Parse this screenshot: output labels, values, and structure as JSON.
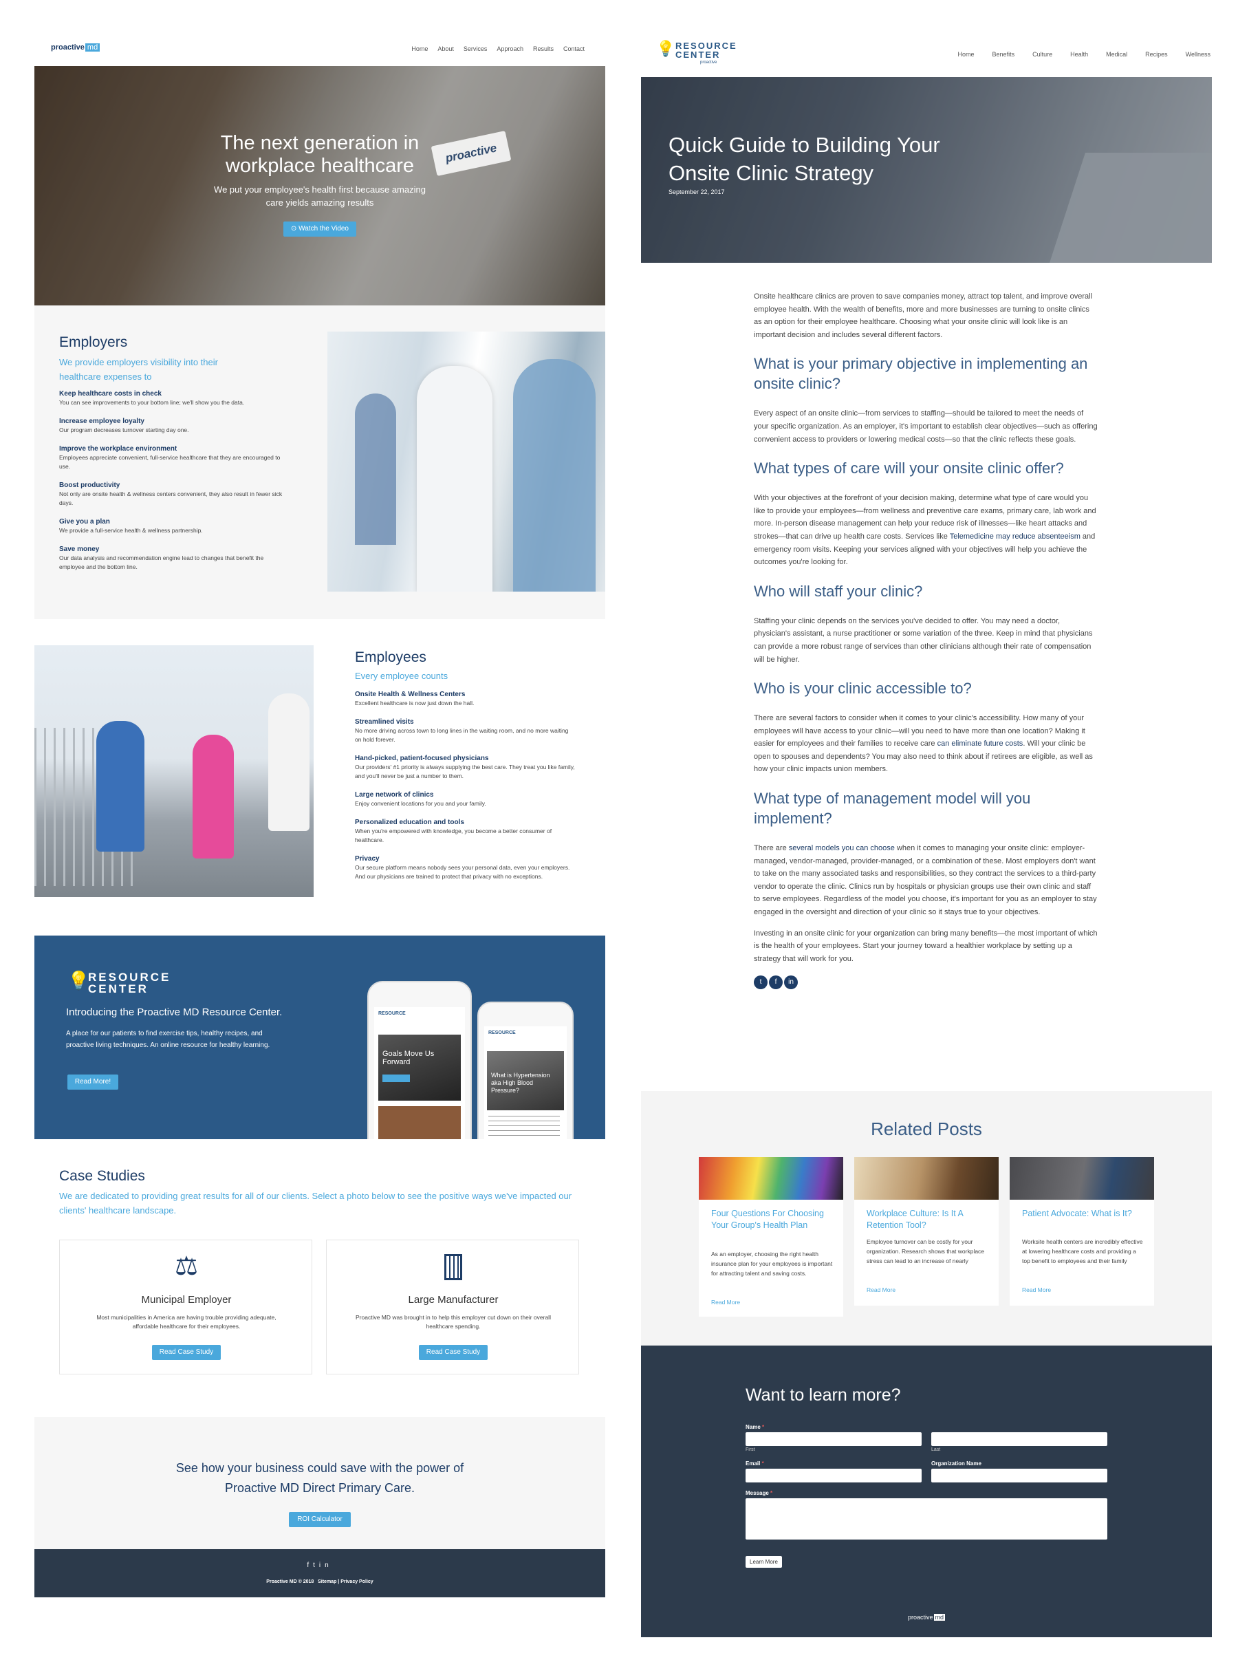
{
  "left": {
    "logo": {
      "text": "proactive",
      "badge": "md"
    },
    "nav": [
      "Home",
      "About",
      "Services",
      "Approach",
      "Results",
      "Contact"
    ],
    "hero": {
      "title": "The next generation in workplace healthcare",
      "subtitle": "We put your employee's health first because amazing care yields amazing results",
      "button": "⊙ Watch the Video"
    },
    "employers": {
      "title": "Employers",
      "subtitle": "We provide employers visibility into their healthcare expenses to",
      "features": [
        {
          "title": "Keep healthcare costs in check",
          "desc": "You can see improvements to your bottom line; we'll show you the data."
        },
        {
          "title": "Increase employee loyalty",
          "desc": "Our program decreases turnover starting day one."
        },
        {
          "title": "Improve the workplace environment",
          "desc": "Employees appreciate convenient, full-service healthcare that they are encouraged to use."
        },
        {
          "title": "Boost productivity",
          "desc": "Not only are onsite health & wellness centers convenient, they also result in fewer sick days."
        },
        {
          "title": "Give you a plan",
          "desc": "We provide a full-service health & wellness partnership."
        },
        {
          "title": "Save money",
          "desc": "Our data analysis and recommendation engine lead to changes that benefit the employee and the bottom line."
        }
      ]
    },
    "employees": {
      "title": "Employees",
      "subtitle": "Every employee counts",
      "features": [
        {
          "title": "Onsite Health & Wellness Centers",
          "desc": "Excellent healthcare is now just down the hall."
        },
        {
          "title": "Streamlined visits",
          "desc": "No more driving across town to long lines in the waiting room, and no more waiting on hold forever."
        },
        {
          "title": "Hand-picked, patient-focused physicians",
          "desc": "Our providers' #1 priority is always supplying the best care. They treat you like family, and you'll never be just a number to them."
        },
        {
          "title": "Large network of clinics",
          "desc": "Enjoy convenient locations for you and your family."
        },
        {
          "title": "Personalized education and tools",
          "desc": "When you're empowered with knowledge, you become a better consumer of healthcare."
        },
        {
          "title": "Privacy",
          "desc": "Our secure platform means nobody sees your personal data, even your employers. And our physicians are trained to protect that privacy with no exceptions."
        }
      ]
    },
    "resource": {
      "logo_line1": "RESOURCE",
      "logo_line2": "CENTER",
      "title": "Introducing the Proactive MD Resource Center.",
      "desc": "A place for our patients to find exercise tips, healthy recipes, and proactive living techniques. An online resource for healthy learning.",
      "button": "Read More!",
      "phone1_caption": "Goals Move Us Forward",
      "phone2_caption": "What is Hypertension aka High Blood Pressure?"
    },
    "case_studies": {
      "title": "Case Studies",
      "subtitle": "We are dedicated to providing great results for all of our clients. Select a photo below to see the positive ways we've impacted our clients' healthcare landscape.",
      "cards": [
        {
          "icon": "scales-icon",
          "title": "Municipal Employer",
          "desc": "Most municipalities in America are having trouble providing adequate, affordable healthcare for their employees.",
          "button": "Read Case Study"
        },
        {
          "icon": "building-icon",
          "title": "Large Manufacturer",
          "desc": "Proactive MD was brought in to help this employer cut down on their overall healthcare spending.",
          "button": "Read Case Study"
        }
      ]
    },
    "cta": {
      "text": "See how your business could save with the power of Proactive MD Direct Primary Care.",
      "button": "ROI Calculator"
    },
    "footer": {
      "copyright": "Proactive MD © 2018",
      "sitemap": "Sitemap",
      "privacy": "Privacy Policy"
    }
  },
  "right": {
    "logo_line1": "RESOURCE",
    "logo_line2": "CENTER",
    "logo_sub": "proactive",
    "nav": [
      "Home",
      "Benefits",
      "Culture",
      "Health",
      "Medical",
      "Recipes",
      "Wellness"
    ],
    "hero": {
      "title": "Quick Guide to Building Your Onsite Clinic Strategy",
      "date": "September 22, 2017"
    },
    "intro": "Onsite healthcare clinics are proven to save companies money, attract top talent, and improve overall employee health. With the wealth of benefits, more and more businesses are turning to onsite clinics as an option for their employee healthcare. Choosing what your onsite clinic will look like is an important decision and includes several different factors.",
    "sections": [
      {
        "heading": "What is your primary objective in implementing an onsite clinic?",
        "body": "Every aspect of an onsite clinic—from services to staffing—should be tailored to meet the needs of your specific organization. As an employer, it's important to establish clear objectives—such as offering convenient access to providers or lowering medical costs—so that the clinic reflects these goals."
      },
      {
        "heading": "What types of care will your onsite clinic offer?",
        "body_pre": "With your objectives at the forefront of your decision making, determine what type of care would you like to provide your employees—from wellness and preventive care exams, primary care, lab work and more.  In-person disease management can help your reduce risk of illnesses—like heart attacks and strokes—that can drive up health care costs. Services like ",
        "link": "Telemedicine may reduce absenteeism",
        "body_post": " and emergency room visits. Keeping your services aligned with your objectives will help you achieve the outcomes you're looking for."
      },
      {
        "heading": "Who will staff your clinic?",
        "body": "Staffing your clinic depends on the services you've decided to offer. You may need a doctor, physician's assistant, a nurse practitioner or some variation of the three. Keep in mind that physicians can provide a more robust range of services than other clinicians although their rate of compensation will be higher."
      },
      {
        "heading": "Who is your clinic accessible to?",
        "body_pre": "There are several factors to consider when it comes to your clinic's accessibility. How many of your employees will have access to your clinic—will you need to have more than one location? Making it easier for employees and their families to receive care ",
        "link": "can eliminate future costs",
        "body_post": ". Will your clinic be open to spouses and dependents? You may also need to think about if retirees are eligible, as well as how your clinic impacts union members."
      },
      {
        "heading": "What type of management model will you implement?",
        "body_pre": "There are ",
        "link": "several models you can choose",
        "body_post": " when it comes to managing your onsite clinic: employer-managed, vendor-managed, provider-managed, or a combination of these. Most employers don't want to take on the many associated tasks and responsibilities, so they contract the services to a third-party vendor to operate the clinic. Clinics run by hospitals or physician groups use their own clinic and staff to serve employees. Regardless of the model you choose, it's important for you as an employer to stay engaged in the oversight and direction of your clinic so it stays true to your objectives."
      }
    ],
    "closing": "Investing in an onsite clinic for your organization can bring many benefits—the most important of which is the health of your employees. Start your journey toward a healthier workplace by setting up a strategy that will work for you.",
    "related": {
      "title": "Related Posts",
      "posts": [
        {
          "title": "Four Questions For Choosing Your Group's Health Plan",
          "desc": "As an employer, choosing the right health insurance plan for your employees is important for attracting talent and saving costs.",
          "more": "Read More"
        },
        {
          "title": "Workplace Culture: Is It A Retention Tool?",
          "desc": "Employee turnover can be costly for your organization. Research shows that workplace stress can lead to an increase of nearly",
          "more": "Read More"
        },
        {
          "title": "Patient Advocate: What is It?",
          "desc": "Worksite health centers are incredibly effective at lowering healthcare costs and providing a top benefit to employees and their family",
          "more": "Read More"
        }
      ]
    },
    "form": {
      "title": "Want to learn more?",
      "name_label": "Name",
      "first": "First",
      "last": "Last",
      "email_label": "Email",
      "org_label": "Organization Name",
      "message_label": "Message",
      "required": "*",
      "button": "Learn More"
    },
    "footer_logo": {
      "text": "proactive",
      "badge": "md"
    }
  }
}
